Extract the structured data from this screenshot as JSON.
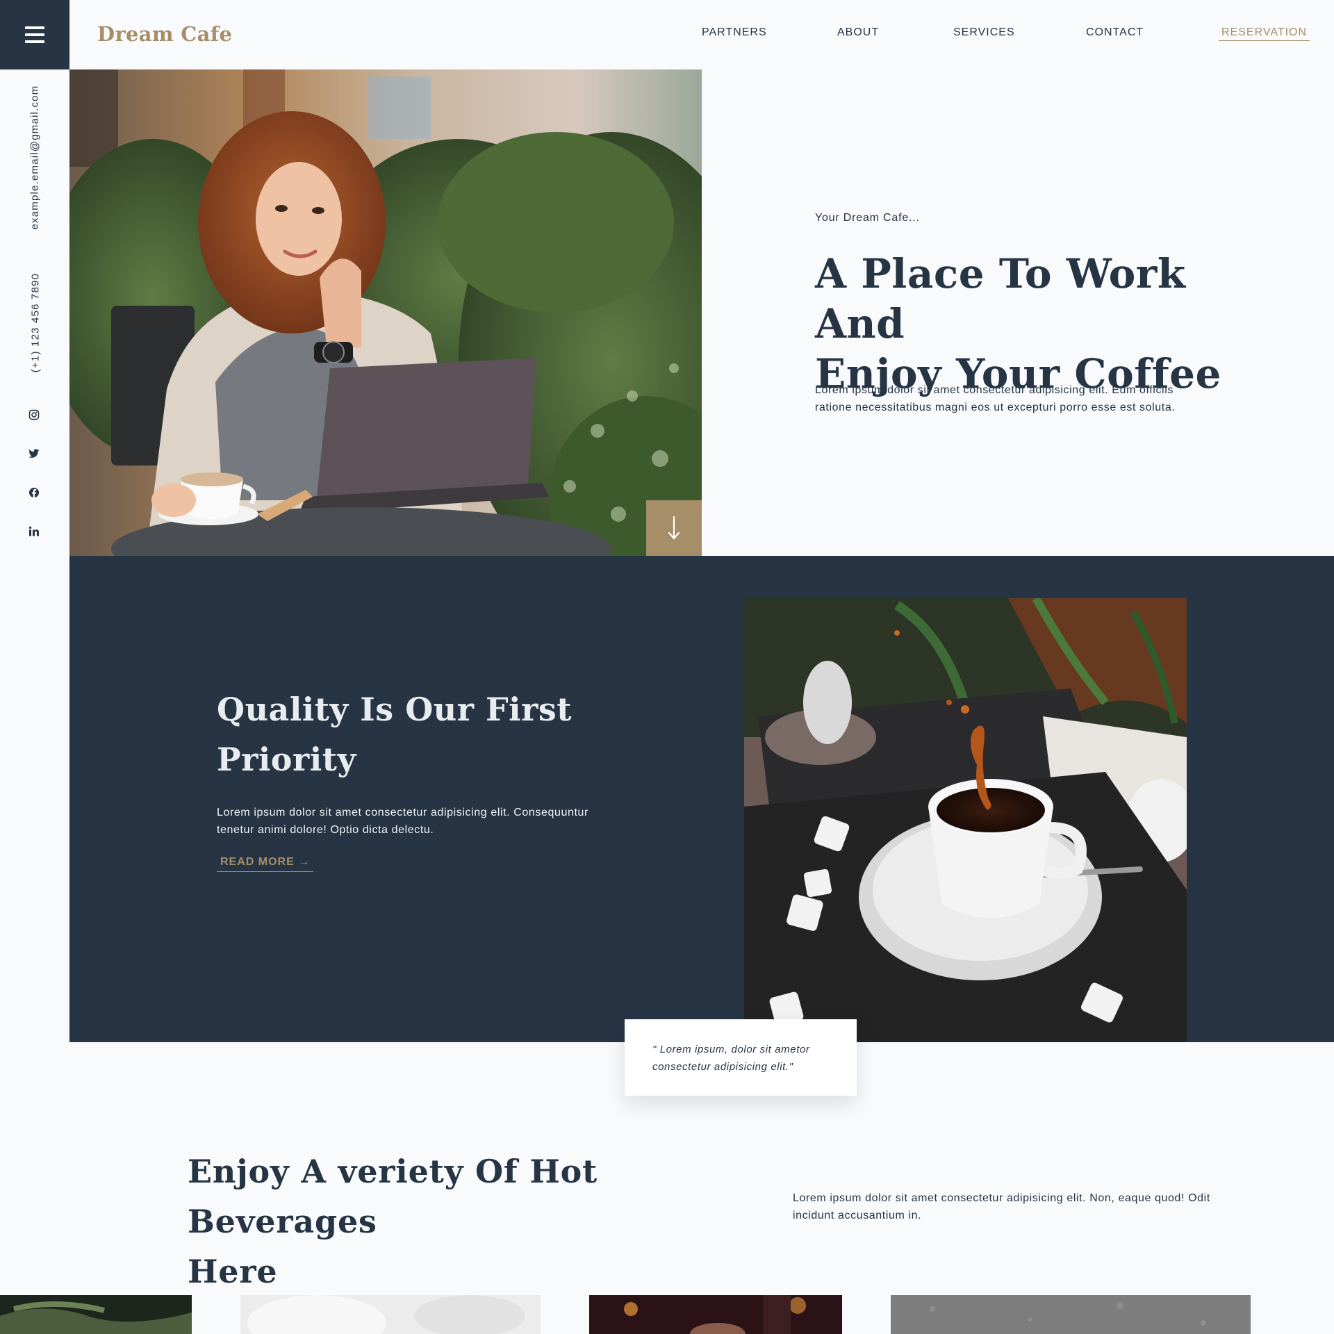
{
  "header": {
    "brand": "Dream Cafe",
    "nav": [
      "PARTNERS",
      "ABOUT",
      "SERVICES",
      "CONTACT"
    ],
    "reservation": "RESERVATION"
  },
  "sidebar": {
    "email": "example.email@gmail.com",
    "phone": "(+1) 123 456 7890",
    "social_icons": [
      "instagram-icon",
      "twitter-icon",
      "facebook-icon",
      "linkedin-icon"
    ]
  },
  "hero": {
    "kicker": "Your Dream Cafe...",
    "title_line1": "A Place To Work And",
    "title_line2": "Enjoy Your Coffee",
    "text": "Lorem ipsum dolor sit amet consectetur adipisicing elit. Eum officiis ratione necessitatibus magni eos ut excepturi porro esse est soluta.",
    "scroll_icon": "arrow-down-icon"
  },
  "quality": {
    "title_line1": "Quality Is Our First",
    "title_line2": "Priority",
    "text": "Lorem ipsum dolor sit amet consectetur adipisicing elit. Consequuntur tenetur animi dolore! Optio dicta delectu.",
    "read_more": "READ MORE →",
    "quote": "\" Lorem ipsum, dolor sit ametor consectetur adipisicing elit.\""
  },
  "beverages": {
    "title_line1": "Enjoy A veriety Of Hot Beverages",
    "title_line2": "Here",
    "text": "Lorem ipsum dolor sit amet consectetur adipisicing elit. Non, eaque quod! Odit incidunt accusantium in."
  },
  "colors": {
    "navy": "#263444",
    "gold": "#a68f68",
    "background": "#f8fafc"
  }
}
